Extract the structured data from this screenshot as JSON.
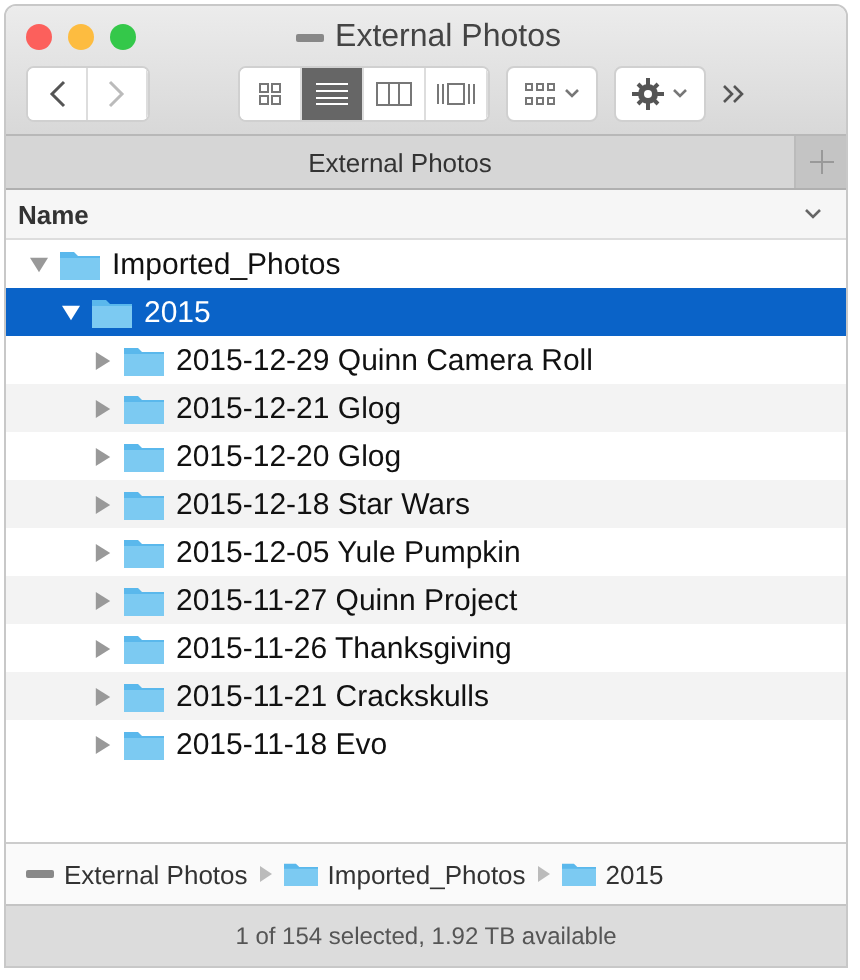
{
  "window": {
    "title": "External Photos"
  },
  "view_modes": [
    {
      "kind": "icons",
      "selected": false
    },
    {
      "kind": "list",
      "selected": true
    },
    {
      "kind": "columns",
      "selected": false
    },
    {
      "kind": "coverflow",
      "selected": false
    }
  ],
  "tab": {
    "label": "External Photos"
  },
  "column_header": {
    "label": "Name"
  },
  "tree": [
    {
      "name": "Imported_Photos",
      "expanded": true,
      "selected": false,
      "children": [
        {
          "name": "2015",
          "expanded": true,
          "selected": true,
          "children": [
            {
              "name": "2015-12-29 Quinn Camera Roll",
              "expanded": false,
              "selected": false
            },
            {
              "name": "2015-12-21 Glog",
              "expanded": false,
              "selected": false
            },
            {
              "name": "2015-12-20 Glog",
              "expanded": false,
              "selected": false
            },
            {
              "name": "2015-12-18 Star Wars",
              "expanded": false,
              "selected": false
            },
            {
              "name": "2015-12-05 Yule Pumpkin",
              "expanded": false,
              "selected": false
            },
            {
              "name": "2015-11-27 Quinn Project",
              "expanded": false,
              "selected": false
            },
            {
              "name": "2015-11-26 Thanksgiving",
              "expanded": false,
              "selected": false
            },
            {
              "name": "2015-11-21 Crackskulls",
              "expanded": false,
              "selected": false
            },
            {
              "name": "2015-11-18 Evo",
              "expanded": false,
              "selected": false
            }
          ]
        }
      ]
    }
  ],
  "path_bar": [
    {
      "kind": "drive",
      "label": "External Photos"
    },
    {
      "kind": "folder",
      "label": "Imported_Photos"
    },
    {
      "kind": "folder",
      "label": "2015"
    }
  ],
  "status_bar": "1 of 154 selected, 1.92 TB available"
}
